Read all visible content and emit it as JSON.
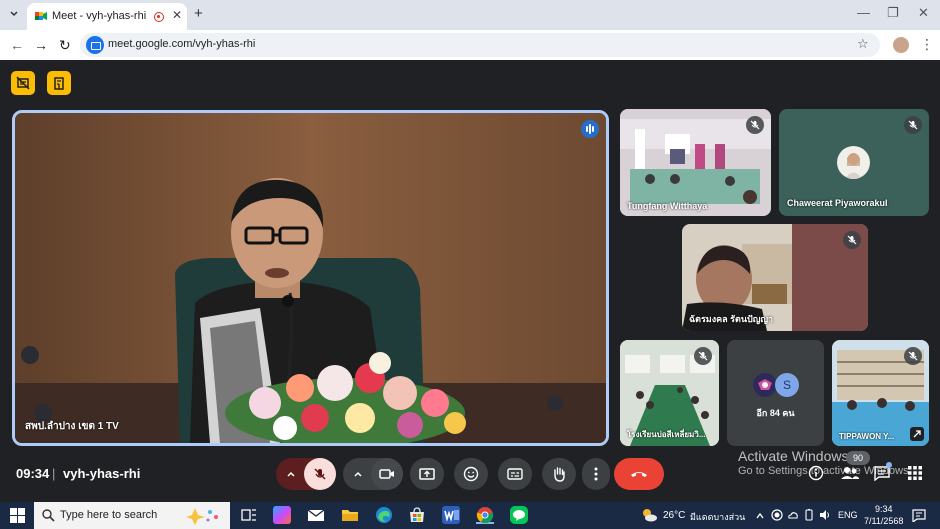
{
  "browser": {
    "tab_title": "Meet - vyh-yhas-rhi",
    "tab_close": "✕",
    "new_tab": "+",
    "url": "meet.google.com/vyh-yhas-rhi",
    "window_controls": {
      "minimize": "—",
      "restore": "❐",
      "close": "✕"
    },
    "nav": {
      "back": "←",
      "forward": "→",
      "reload": "↻"
    },
    "star": "☆",
    "menu": "⋮"
  },
  "meet": {
    "main_speaker": {
      "label": "สพป.ลำปาง เขต 1 TV"
    },
    "tiles": [
      {
        "label": "Tungfang Witthaya"
      },
      {
        "label": "Chaweerat Piyaworakul"
      },
      {
        "label": "ฉัตรมงคล รัตนปัญญา"
      },
      {
        "label": "โรงเรียนบ่อสีเหลี่ยมวิ..."
      },
      {
        "label": "อีก 84 คน",
        "avatar_letter": "S"
      },
      {
        "label": "TIPPAWON Y..."
      }
    ],
    "time": "09:34",
    "separator": "|",
    "meeting_code": "vyh-yhas-rhi",
    "participant_count": "90"
  },
  "watermark": {
    "title": "Activate Windows",
    "subtitle": "Go to Settings to activate Windows."
  },
  "taskbar": {
    "search_placeholder": "Type here to search",
    "weather": "26°C",
    "weather_desc": "มีแดดบางส่วน",
    "lang": "ENG",
    "time": "9:34",
    "date": "7/11/2568"
  },
  "colors": {
    "meet_bg": "#202124",
    "control_grey": "#3c4043",
    "hangup_red": "#ea4335",
    "mic_off_red": "#f28b82",
    "highlight_yellow": "#fbbc04",
    "active_border": "#aecbfa"
  }
}
